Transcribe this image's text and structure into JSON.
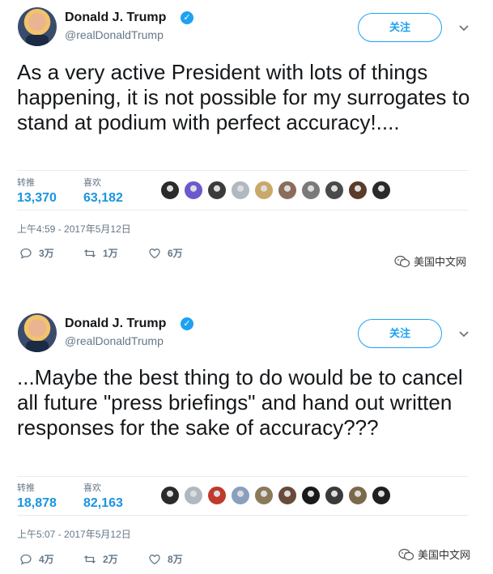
{
  "tweets": [
    {
      "name": "Donald J. Trump",
      "handle": "@realDonaldTrump",
      "follow_label": "关注",
      "text": "As a very active President with lots of things happening, it is not possible for my surrogates to stand at podium with perfect accuracy!....",
      "retweets_label": "转推",
      "retweets_value": "13,370",
      "likes_label": "喜欢",
      "likes_value": "63,182",
      "timestamp": "上午4:59 - 2017年5月12日",
      "reply_count": "3万",
      "retweet_count": "1万",
      "like_count": "6万",
      "liker_colors": [
        "#2b2b2b",
        "#6a5acd",
        "#3b3b3b",
        "#b0b8c1",
        "#c9a86a",
        "#8a6d5a",
        "#7a7a7a",
        "#4a4a4a",
        "#5a3b2a",
        "#2a2a2a"
      ]
    },
    {
      "name": "Donald J. Trump",
      "handle": "@realDonaldTrump",
      "follow_label": "关注",
      "text": "...Maybe the best thing to do would be to cancel all future \"press briefings\" and hand out written responses for the sake of accuracy???",
      "retweets_label": "转推",
      "retweets_value": "18,878",
      "likes_label": "喜欢",
      "likes_value": "82,163",
      "timestamp": "上午5:07 - 2017年5月12日",
      "reply_count": "4万",
      "retweet_count": "2万",
      "like_count": "8万",
      "liker_colors": [
        "#2b2b2b",
        "#b0b8c1",
        "#c0392b",
        "#8aa0c0",
        "#8a7a5a",
        "#6a4a3a",
        "#1a1a1a",
        "#3a3a3a",
        "#7a6a4a",
        "#1f1f1f"
      ]
    }
  ],
  "watermark": "美国中文网",
  "colors": {
    "accent": "#1da1f2",
    "stat_value": "#1b95e0",
    "muted": "#657786"
  }
}
